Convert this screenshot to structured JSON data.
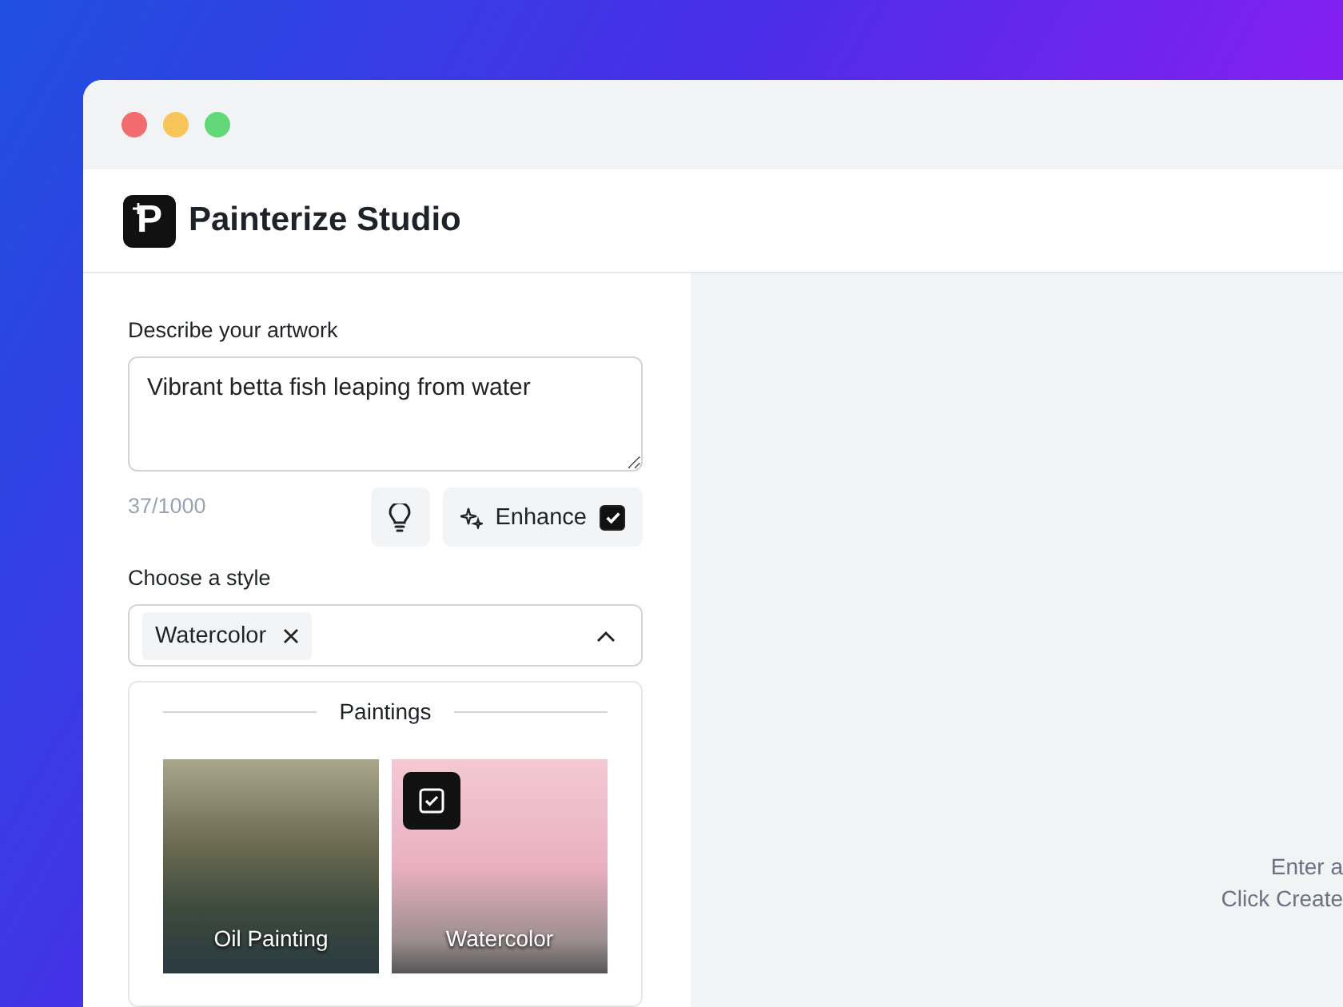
{
  "app": {
    "logo_letter": "P",
    "name": "Painterize Studio"
  },
  "prompt": {
    "label": "Describe your artwork",
    "value": "Vibrant betta fish leaping from water",
    "counter": "37/1000",
    "enhance": {
      "label": "Enhance",
      "checked": true
    }
  },
  "style": {
    "label": "Choose a style",
    "tags": [
      {
        "label": "Watercolor"
      }
    ],
    "expanded": true,
    "group": "Paintings",
    "options": [
      {
        "label": "Oil Painting",
        "selected": false,
        "kind": "oil"
      },
      {
        "label": "Watercolor",
        "selected": true,
        "kind": "watercolor"
      }
    ]
  },
  "preview": {
    "lines": [
      "Enter a",
      "Click Create"
    ]
  }
}
